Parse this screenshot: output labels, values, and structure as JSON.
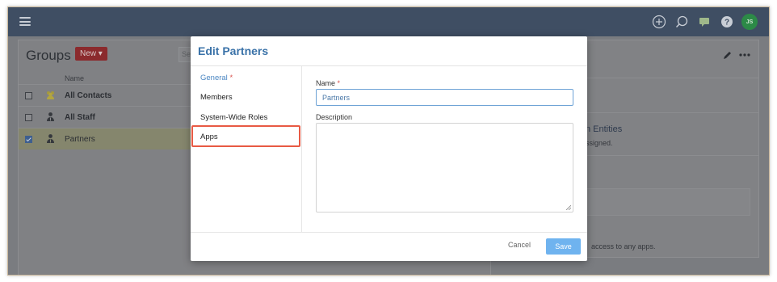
{
  "topbar": {
    "icons": [
      "menu-icon",
      "add-circle-icon",
      "search-icon",
      "chat-icon",
      "help-icon"
    ],
    "avatar_initials": "JS"
  },
  "groups_panel": {
    "title": "Groups",
    "new_button": "New",
    "search_stub": "Se",
    "column_name": "Name",
    "rows": [
      {
        "name": "All Contacts",
        "checked": false,
        "icon": "group-yellow-icon"
      },
      {
        "name": "All Staff",
        "checked": false,
        "icon": "group-dark-icon"
      },
      {
        "name": "Partners",
        "checked": true,
        "icon": "group-dark-icon"
      }
    ]
  },
  "detail_panel": {
    "entities_text": "n Entities",
    "assigned_text": "ssigned.",
    "apps_text": "access to any apps."
  },
  "modal": {
    "title": "Edit Partners",
    "nav": {
      "general": "General",
      "general_required": "*",
      "members": "Members",
      "roles": "System-Wide Roles",
      "apps": "Apps"
    },
    "form": {
      "name_label": "Name",
      "name_required": "*",
      "name_value": "Partners",
      "description_label": "Description",
      "description_value": ""
    },
    "footer": {
      "cancel": "Cancel",
      "save": "Save"
    }
  },
  "colors": {
    "accent": "#3a72a8",
    "save_button": "#6fb3ef",
    "highlight": "#e85a44",
    "new_button": "#8b2a2d"
  }
}
